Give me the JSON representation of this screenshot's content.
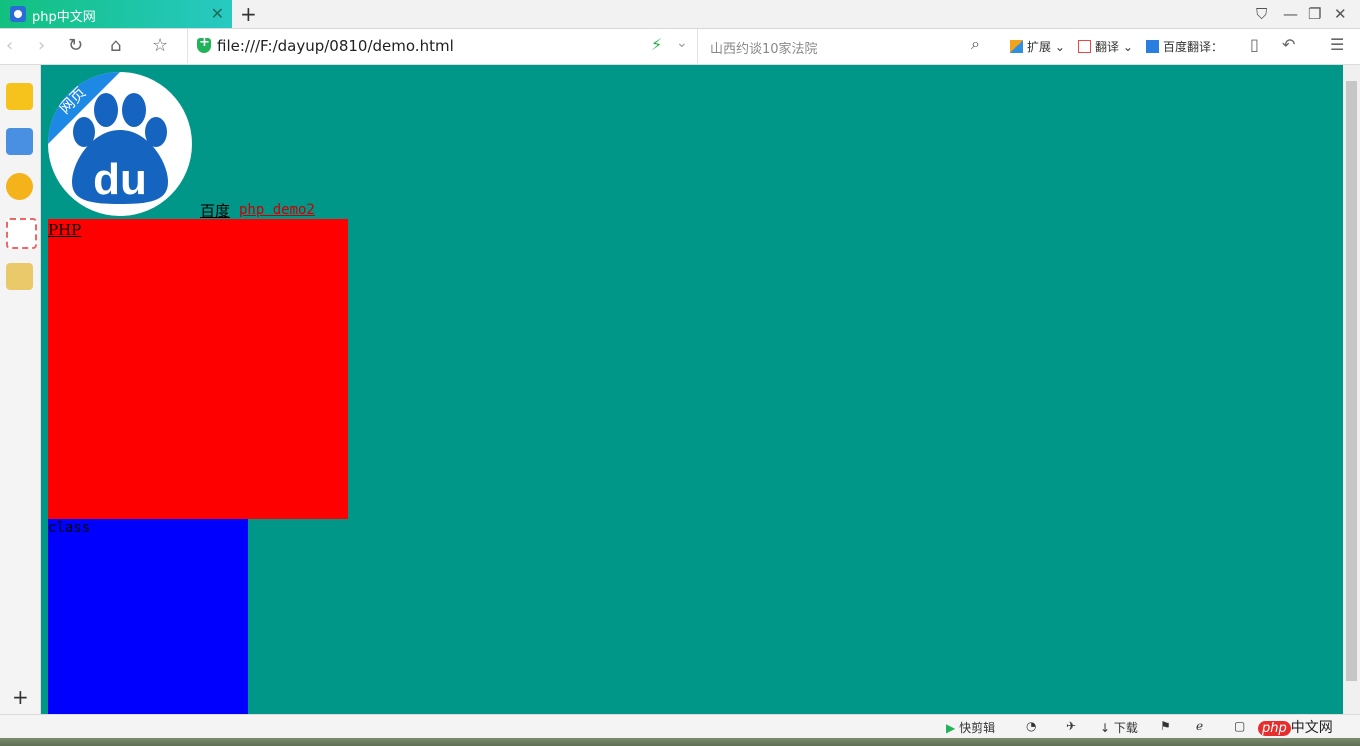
{
  "tab": {
    "title": "php中文网"
  },
  "address": {
    "url": "file:///F:/dayup/0810/demo.html"
  },
  "search": {
    "placeholder": "山西约谈10家法院"
  },
  "extensions": {
    "expand": "扩展",
    "translate": "翻译",
    "baidu_translate": "百度翻译："
  },
  "colors": {
    "page_bg": "#009688",
    "red_box": "#ff0000",
    "blue_box": "#0000ff",
    "tab_accent": "#12c07e"
  },
  "page": {
    "logo_ribbon": "网页",
    "logo_text": "du",
    "link_baidu": "百度",
    "link_php": "php demo2",
    "red_box_label": "PHP",
    "blue_box_label": "class"
  },
  "status": {
    "quick_clip": "快剪辑",
    "download": "下载",
    "php_logo": "php",
    "php_logo_rest": "中文网"
  }
}
